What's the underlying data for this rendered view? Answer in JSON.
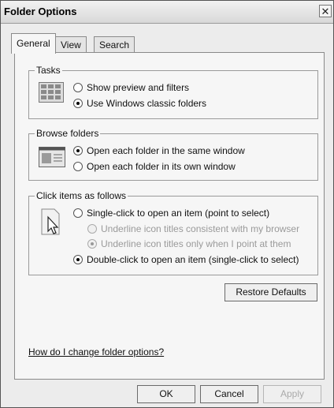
{
  "window": {
    "title": "Folder Options",
    "close_glyph": "✕"
  },
  "tabs": [
    {
      "label": "General",
      "active": true
    },
    {
      "label": "View",
      "active": false
    },
    {
      "label": "Search",
      "active": false
    }
  ],
  "tasks": {
    "legend": "Tasks",
    "icon": "windows-preview-icon",
    "options": [
      {
        "label": "Show preview and filters",
        "checked": false,
        "enabled": true
      },
      {
        "label": "Use Windows classic folders",
        "checked": true,
        "enabled": true
      }
    ]
  },
  "browse": {
    "legend": "Browse folders",
    "icon": "folder-window-icon",
    "options": [
      {
        "label": "Open each folder in the same window",
        "checked": true,
        "enabled": true
      },
      {
        "label": "Open each folder in its own window",
        "checked": false,
        "enabled": true
      }
    ]
  },
  "click": {
    "legend": "Click items as follows",
    "icon": "cursor-click-icon",
    "options": [
      {
        "label": "Single-click to open an item (point to select)",
        "checked": false,
        "enabled": true
      },
      {
        "label": "Underline icon titles consistent with my browser",
        "checked": false,
        "enabled": false
      },
      {
        "label": "Underline icon titles only when I point at them",
        "checked": true,
        "enabled": false
      },
      {
        "label": "Double-click to open an item (single-click to select)",
        "checked": true,
        "enabled": true
      }
    ]
  },
  "restore_label": "Restore Defaults",
  "help_link": "How do I change folder options?",
  "buttons": {
    "ok": "OK",
    "cancel": "Cancel",
    "apply": "Apply"
  }
}
